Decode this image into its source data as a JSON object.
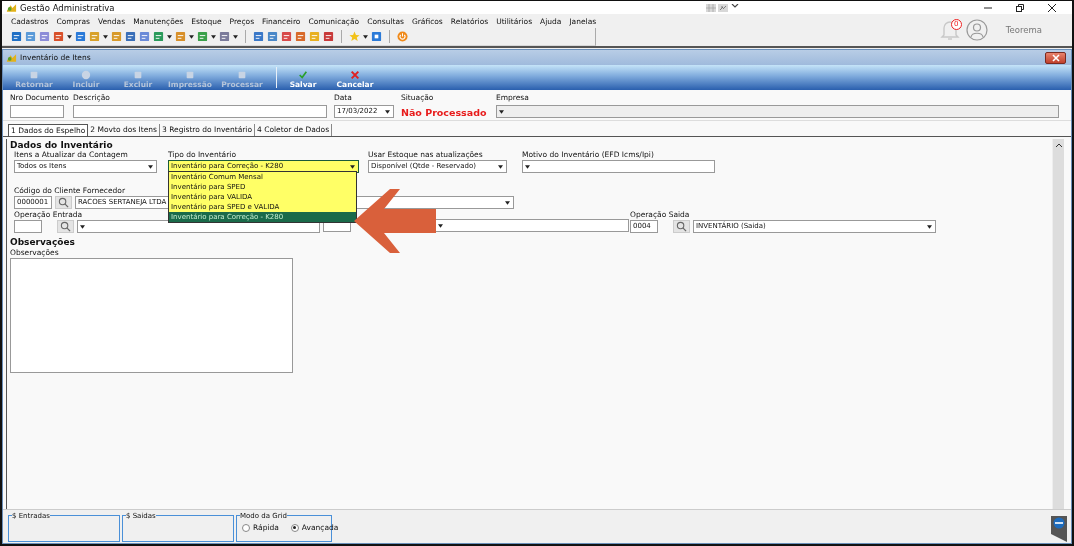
{
  "window": {
    "title": "Gestão Administrativa"
  },
  "menu": [
    "Cadastros",
    "Compras",
    "Vendas",
    "Manutenções",
    "Estoque",
    "Preços",
    "Financeiro",
    "Comunicação",
    "Consultas",
    "Gráficos",
    "Relatórios",
    "Utilitários",
    "Ajuda",
    "Janelas"
  ],
  "notifications": {
    "count": "0"
  },
  "user": {
    "name": "Teorema"
  },
  "form": {
    "title": "Inventário de Itens",
    "toolbar": [
      {
        "label": "Retornar",
        "kind": "back",
        "disabled": true
      },
      {
        "label": "Incluir",
        "kind": "add",
        "disabled": true
      },
      {
        "label": "Excluir",
        "kind": "delete",
        "disabled": true
      },
      {
        "label": "Impressão",
        "kind": "print",
        "disabled": true
      },
      {
        "label": "Processar",
        "kind": "process",
        "disabled": true
      },
      {
        "label": "Salvar",
        "kind": "save",
        "disabled": false
      },
      {
        "label": "Cancelar",
        "kind": "cancel",
        "disabled": false
      }
    ],
    "header": {
      "nro_documento": {
        "label": "Nro Documento"
      },
      "descricao": {
        "label": "Descrição"
      },
      "data": {
        "label": "Data",
        "value": "17/03/2022"
      },
      "situacao": {
        "label": "Situação",
        "value": "Não Processado"
      },
      "empresa": {
        "label": "Empresa"
      }
    },
    "tabs": [
      {
        "label": "1 Dados do Espelho",
        "selected": true
      },
      {
        "label": "2 Movto dos Itens",
        "selected": false
      },
      {
        "label": "3 Registro do Inventário",
        "selected": false
      },
      {
        "label": "4 Coletor de Dados",
        "selected": false
      }
    ],
    "section_title": "Dados do Inventário",
    "itens_atualizar": {
      "label": "Itens a Atualizar da Contagem",
      "value": "Todos os Itens"
    },
    "tipo_inventario": {
      "label": "Tipo do Inventário",
      "value": "Inventário para Correção - K280",
      "expanded": true,
      "options": [
        {
          "label": "Inventário Comum Mensal",
          "selected": false
        },
        {
          "label": "Inventário para SPED",
          "selected": false
        },
        {
          "label": "Inventário para VALIDA",
          "selected": false
        },
        {
          "label": "Inventário para SPED e VALIDA",
          "selected": false
        },
        {
          "label": "Inventário para Correção - K280",
          "selected": true
        }
      ]
    },
    "usar_estoque": {
      "label": "Usar Estoque nas atualizações",
      "value": "Disponível (Qtde - Reservado)"
    },
    "motivo": {
      "label": "Motivo do Inventário (EFD Icms/Ipi)"
    },
    "cliente_fornecedor": {
      "label": "Código do Cliente Fornecedor",
      "code": "0000001",
      "name": "RACOES SERTANEJA LTDA"
    },
    "operacao_entrada": {
      "label": "Operação Entrada"
    },
    "operacao_saida": {
      "label": "Operação Saida",
      "code": "0004",
      "name": "INVENTÁRIO (Saida)"
    },
    "observacoes": {
      "title": "Observações",
      "label": "Observações"
    },
    "totals": [
      {
        "label": "$ Entradas"
      },
      {
        "label": "$ Saidas"
      }
    ],
    "grid_mode": {
      "label": "Modo da Grid",
      "options": [
        {
          "label": "Rápida",
          "selected": false
        },
        {
          "label": "Avançada",
          "selected": true
        }
      ]
    }
  }
}
